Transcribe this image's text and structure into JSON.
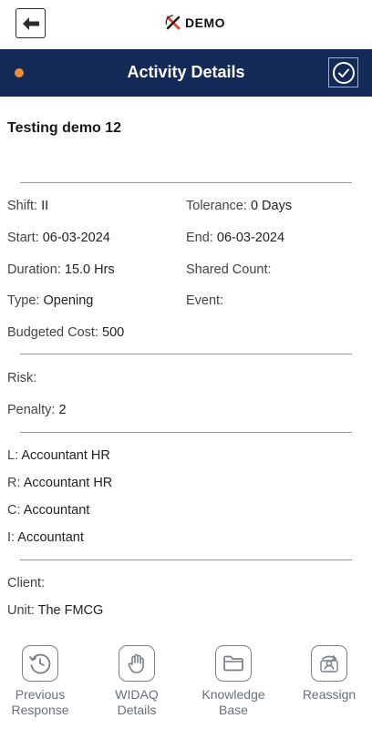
{
  "brand": {
    "name": "DEMO",
    "logo_icon": "x-logo-icon"
  },
  "header": {
    "title": "Activity Details",
    "status_color": "#f28c38",
    "bg_color": "#132a57"
  },
  "activity": {
    "name": "Testing demo 12"
  },
  "details": {
    "shift": {
      "label": "Shift:",
      "value": "II"
    },
    "tolerance": {
      "label": "Tolerance:",
      "value": "0 Days"
    },
    "start": {
      "label": "Start:",
      "value": "06-03-2024"
    },
    "end": {
      "label": "End:",
      "value": "06-03-2024"
    },
    "duration": {
      "label": "Duration:",
      "value": "15.0 Hrs"
    },
    "shared_count": {
      "label": "Shared Count:",
      "value": ""
    },
    "type": {
      "label": "Type:",
      "value": "Opening"
    },
    "event": {
      "label": "Event:",
      "value": ""
    },
    "budgeted_cost": {
      "label": "Budgeted Cost:",
      "value": "500"
    }
  },
  "risk": {
    "risk": {
      "label": "Risk:",
      "value": ""
    },
    "penalty": {
      "label": "Penalty:",
      "value": "2"
    }
  },
  "raci": {
    "l": {
      "label": "L:",
      "value": "Accountant HR"
    },
    "r": {
      "label": "R:",
      "value": "Accountant HR"
    },
    "c": {
      "label": "C:",
      "value": "Accountant"
    },
    "i": {
      "label": "I:",
      "value": "Accountant"
    }
  },
  "org": {
    "client": {
      "label": "Client:",
      "value": ""
    },
    "unit": {
      "label": "Unit:",
      "value": "The FMCG"
    }
  },
  "bottom_nav": [
    {
      "line1": "Previous",
      "line2": "Response",
      "icon": "history-clock-icon"
    },
    {
      "line1": "WIDAQ",
      "line2": "Details",
      "icon": "hand-icon"
    },
    {
      "line1": "Knowledge",
      "line2": "Base",
      "icon": "folder-icon"
    },
    {
      "line1": "Reassign",
      "line2": "",
      "icon": "reassign-user-icon"
    }
  ]
}
